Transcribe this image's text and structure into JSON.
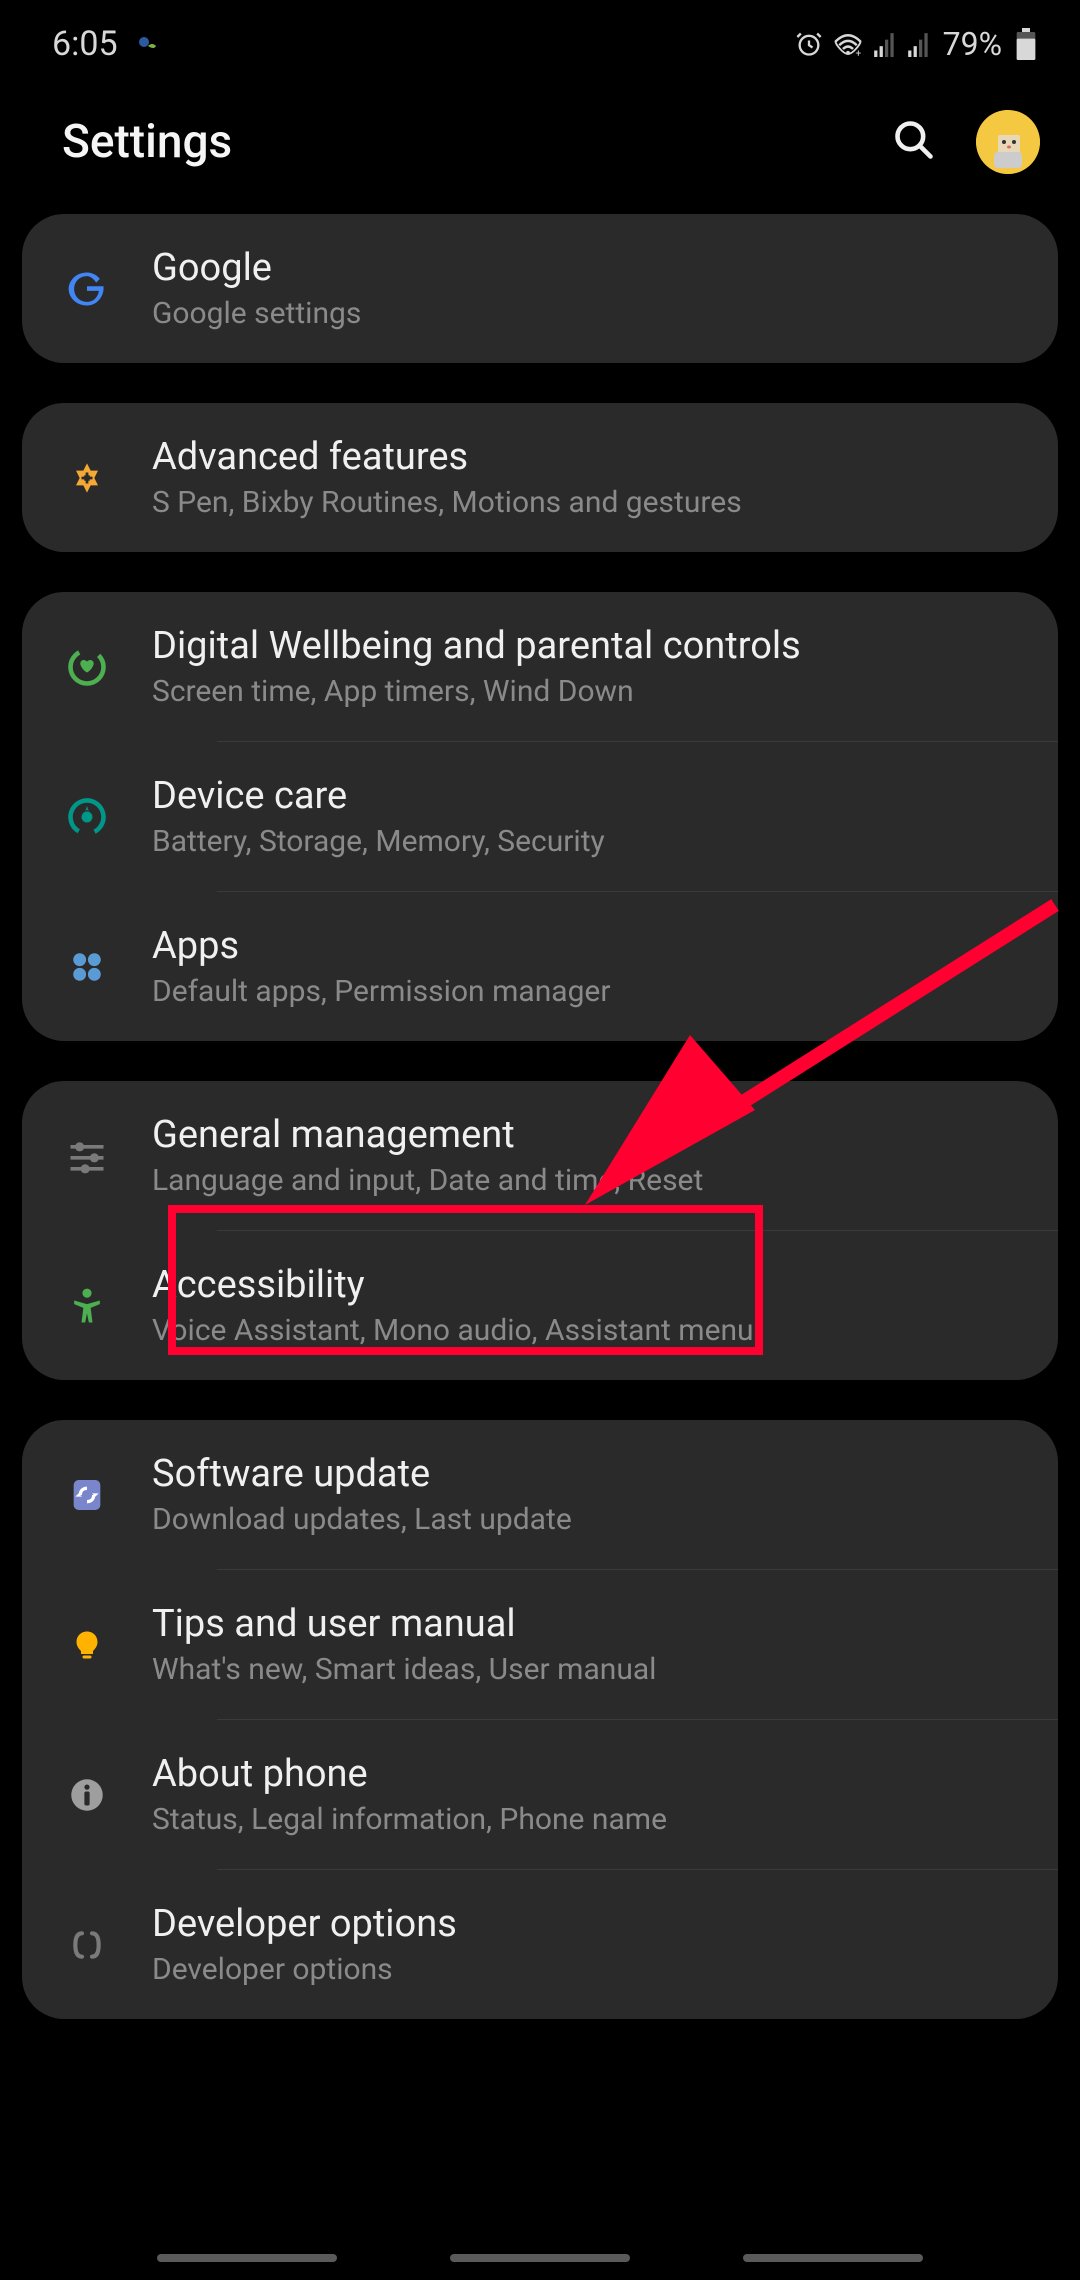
{
  "statusBar": {
    "time": "6:05",
    "battery": "79%"
  },
  "header": {
    "title": "Settings"
  },
  "groups": [
    {
      "items": [
        {
          "id": "google",
          "title": "Google",
          "subtitle": "Google settings",
          "iconColor": "#4285f4"
        }
      ]
    },
    {
      "items": [
        {
          "id": "advanced-features",
          "title": "Advanced features",
          "subtitle": "S Pen, Bixby Routines, Motions and gestures",
          "iconColor": "#f4a836"
        }
      ]
    },
    {
      "items": [
        {
          "id": "digital-wellbeing",
          "title": "Digital Wellbeing and parental controls",
          "subtitle": "Screen time, App timers, Wind Down",
          "iconColor": "#4caf50"
        },
        {
          "id": "device-care",
          "title": "Device care",
          "subtitle": "Battery, Storage, Memory, Security",
          "iconColor": "#009688"
        },
        {
          "id": "apps",
          "title": "Apps",
          "subtitle": "Default apps, Permission manager",
          "iconColor": "#5b9bd5"
        }
      ]
    },
    {
      "items": [
        {
          "id": "general-management",
          "title": "General management",
          "subtitle": "Language and input, Date and time, Reset",
          "iconColor": "#7a7a7a",
          "highlighted": true
        },
        {
          "id": "accessibility",
          "title": "Accessibility",
          "subtitle": "Voice Assistant, Mono audio, Assistant menu",
          "iconColor": "#4caf50"
        }
      ]
    },
    {
      "items": [
        {
          "id": "software-update",
          "title": "Software update",
          "subtitle": "Download updates, Last update",
          "iconColor": "#7986cb"
        },
        {
          "id": "tips",
          "title": "Tips and user manual",
          "subtitle": "What's new, Smart ideas, User manual",
          "iconColor": "#ffb300"
        },
        {
          "id": "about-phone",
          "title": "About phone",
          "subtitle": "Status, Legal information, Phone name",
          "iconColor": "#9e9e9e"
        },
        {
          "id": "developer-options",
          "title": "Developer options",
          "subtitle": "Developer options",
          "iconColor": "#7a7a7a"
        }
      ]
    }
  ],
  "annotation": {
    "highlightColor": "#ff0030",
    "arrowColor": "#ff0030"
  }
}
